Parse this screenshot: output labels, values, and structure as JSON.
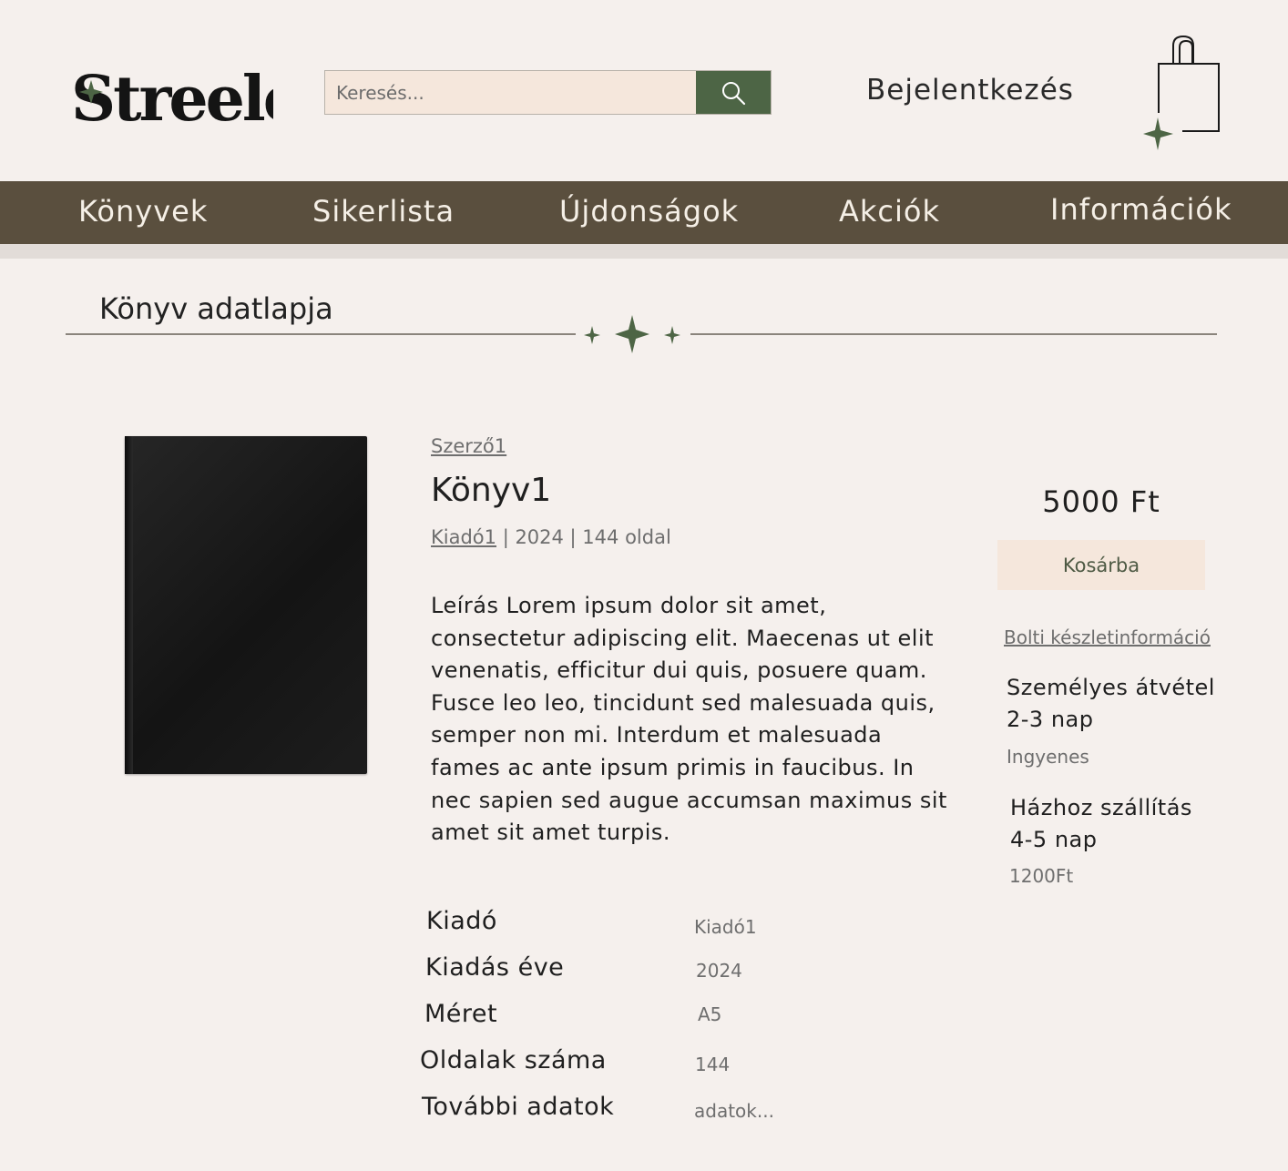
{
  "header": {
    "logo_text": "Streeler",
    "search": {
      "placeholder": "Keresés..."
    },
    "login_label": "Bejelentkezés"
  },
  "nav": {
    "items": [
      "Könyvek",
      "Sikerlista",
      "Újdonságok",
      "Akciók",
      "Információk"
    ]
  },
  "page": {
    "section_title": "Könyv adatlapja"
  },
  "book": {
    "author": "Szerző1",
    "title": "Könyv1",
    "publisher": "Kiadó1",
    "meta_rest": " | 2024 | 144 oldal",
    "description": "Leírás Lorem ipsum dolor sit amet, consectetur adipiscing elit. Maecenas ut elit venenatis, efficitur dui quis, posuere quam. Fusce leo leo, tincidunt sed malesuada quis, semper non mi. Interdum et malesuada fames ac ante ipsum primis in faucibus. In nec sapien sed augue accumsan maximus sit amet sit amet turpis."
  },
  "details": [
    {
      "label": "Kiadó",
      "value": "Kiadó1"
    },
    {
      "label": "Kiadás éve",
      "value": "2024"
    },
    {
      "label": "Méret",
      "value": "A5"
    },
    {
      "label": "Oldalak száma",
      "value": "144"
    },
    {
      "label": "További adatok",
      "value": "adatok..."
    }
  ],
  "purchase": {
    "price": "5000 Ft",
    "add_to_cart_label": "Kosárba",
    "stock_link": "Bolti készletinformáció",
    "shipping": [
      {
        "line1": "Személyes átvétel",
        "line2": "2-3 nap",
        "price": "Ingyenes"
      },
      {
        "line1": "Házhoz szállítás",
        "line2": "4-5 nap",
        "price": "1200Ft"
      }
    ]
  },
  "colors": {
    "background": "#f5f0ed",
    "nav_bg": "#5a4f3e",
    "accent_green": "#4d6545",
    "search_bg": "#f5e7dc",
    "button_bg": "#f5e7dc"
  },
  "icons": [
    "logo-sparkle-icon",
    "search-icon",
    "shopping-bag-icon",
    "sparkle-icon"
  ]
}
